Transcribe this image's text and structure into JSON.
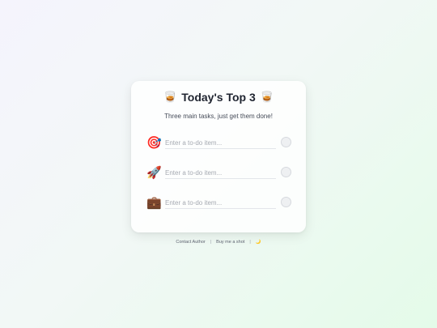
{
  "card": {
    "title": "Today's Top 3",
    "title_emoji_left": "🥃",
    "title_emoji_right": "🥃",
    "subtitle": "Three main tasks, just get them done!"
  },
  "tasks": [
    {
      "icon": "🎯",
      "icon_name": "target-icon",
      "value": "",
      "placeholder": "Enter a to-do item...",
      "done": false
    },
    {
      "icon": "🚀",
      "icon_name": "rocket-icon",
      "value": "",
      "placeholder": "Enter a to-do item...",
      "done": false
    },
    {
      "icon": "💼",
      "icon_name": "briefcase-icon",
      "value": "",
      "placeholder": "Enter a to-do item...",
      "done": false
    }
  ],
  "footer": {
    "contact_label": "Contact Author",
    "separator": "|",
    "buy_label": "Buy me a shot",
    "theme_toggle_icon": "🌙"
  }
}
